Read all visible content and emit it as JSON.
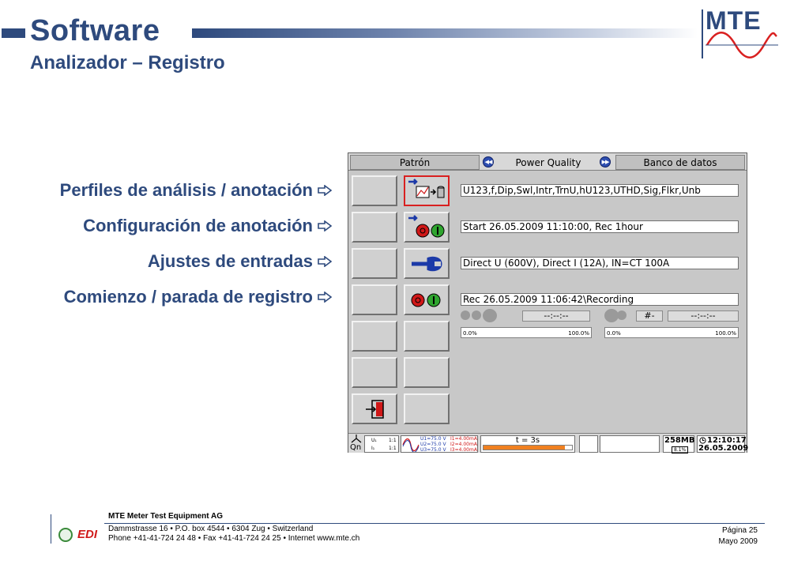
{
  "header": {
    "title": "Software",
    "subtitle": "Analizador – Registro",
    "logo_text": "MTE"
  },
  "features": [
    {
      "label": "Perfiles de análisis / anotación"
    },
    {
      "label": "Configuración de anotación"
    },
    {
      "label": "Ajustes de entradas"
    },
    {
      "label": "Comienzo / parada de registro"
    }
  ],
  "screen": {
    "tabs": {
      "left": "Patrón",
      "center": "Power Quality",
      "right": "Banco de datos"
    },
    "fields": {
      "profile": "U123,f,Dip,Swl,Intr,TrnU,hU123,UTHD,Sig,Flkr,Unb",
      "annotation": "Start 26.05.2009 11:10:00, Rec 1hour",
      "inputs": "Direct U (600V), Direct I (12A), IN=CT 100A",
      "recording": "Rec 26.05.2009 11:06:42\\Recording"
    },
    "indicators": {
      "time_left": "--:--:--",
      "hash": "#-",
      "time_right": "--:--:--",
      "progress_min_left": "0.0%",
      "progress_max_left": "100.0%",
      "progress_min_right": "0.0%",
      "progress_max_right": "100.0%"
    },
    "status": {
      "qn_label": "Qn",
      "u_label": "U₁",
      "i_label": "I₁",
      "ratio_1": "1:1",
      "ratio_2": "1:1",
      "u1": "U1=75.0 V",
      "u2": "U2=75.0 V",
      "u3": "U3=75.0 V",
      "i1": "I1=4.00mA",
      "i2": "I2=4.00mA",
      "i3": "I3=4.00mA",
      "t_label": "t = 3s",
      "t_progress": 0.92,
      "memory": "258MB",
      "memory_sub": "8.1%",
      "clock_time": "12:10:17",
      "clock_date": "26.05.2009"
    },
    "colors": {
      "button_selected": "#d92020",
      "stop_red": "#d01818",
      "start_green": "#2fa52f",
      "progress_orange": "#f08020"
    }
  },
  "footer": {
    "company": "MTE Meter Test Equipment AG",
    "address": "Dammstrasse 16 • P.O. box 4544 • 6304 Zug • Switzerland",
    "contact": "Phone +41-41-724 24 48 • Fax +41-41-724 24 25 • Internet www.mte.ch",
    "edi_label": "EDI",
    "page": "Página 25",
    "date": "Mayo 2009"
  }
}
